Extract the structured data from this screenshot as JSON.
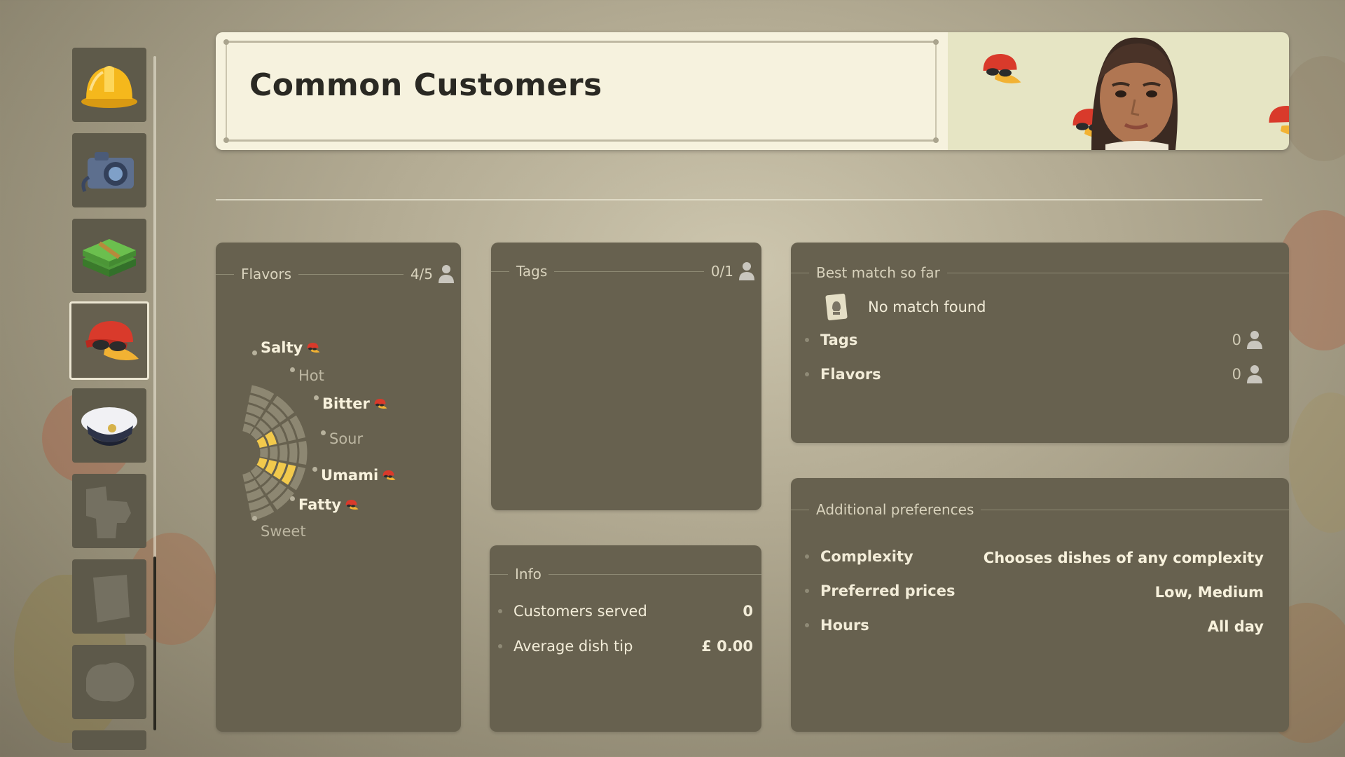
{
  "header": {
    "title": "Common Customers"
  },
  "sidebar": {
    "items": [
      {
        "icon": "hard-hat-icon",
        "state": "normal"
      },
      {
        "icon": "camera-icon",
        "state": "normal"
      },
      {
        "icon": "cash-stack-icon",
        "state": "normal"
      },
      {
        "icon": "red-cap-icon",
        "state": "selected"
      },
      {
        "icon": "captain-hat-icon",
        "state": "normal"
      },
      {
        "icon": "locked-silhouette-icon",
        "state": "locked"
      },
      {
        "icon": "locked-silhouette-icon",
        "state": "locked"
      },
      {
        "icon": "locked-silhouette-icon",
        "state": "locked"
      }
    ]
  },
  "flavors": {
    "heading": "Flavors",
    "count": "4/5",
    "items": [
      {
        "label": "Salty",
        "active": true,
        "preferred": true
      },
      {
        "label": "Hot",
        "active": false,
        "preferred": false
      },
      {
        "label": "Bitter",
        "active": true,
        "preferred": true
      },
      {
        "label": "Sour",
        "active": false,
        "preferred": false
      },
      {
        "label": "Umami",
        "active": true,
        "preferred": true
      },
      {
        "label": "Fatty",
        "active": true,
        "preferred": true
      },
      {
        "label": "Sweet",
        "active": false,
        "preferred": false
      }
    ],
    "radar_levels": [
      0,
      0,
      2,
      0,
      4,
      0,
      0
    ],
    "accent": "#f2c94c"
  },
  "tags": {
    "heading": "Tags",
    "count": "0/1"
  },
  "info": {
    "heading": "Info",
    "rows": [
      {
        "label": "Customers served",
        "value": "0"
      },
      {
        "label": "Average dish tip",
        "value": "£ 0.00"
      }
    ]
  },
  "best_match": {
    "heading": "Best match so far",
    "result": "No match found",
    "rows": [
      {
        "label": "Tags",
        "value": "0"
      },
      {
        "label": "Flavors",
        "value": "0"
      }
    ]
  },
  "preferences": {
    "heading": "Additional preferences",
    "rows": [
      {
        "label": "Complexity",
        "value": "Chooses dishes of any complexity"
      },
      {
        "label": "Preferred prices",
        "value": "Low, Medium"
      },
      {
        "label": "Hours",
        "value": "All day"
      }
    ]
  },
  "colors": {
    "panel": "#67614f",
    "banner": "#f6f2de",
    "accent_yellow": "#f2c94c",
    "cap_red": "#d93a2b"
  }
}
